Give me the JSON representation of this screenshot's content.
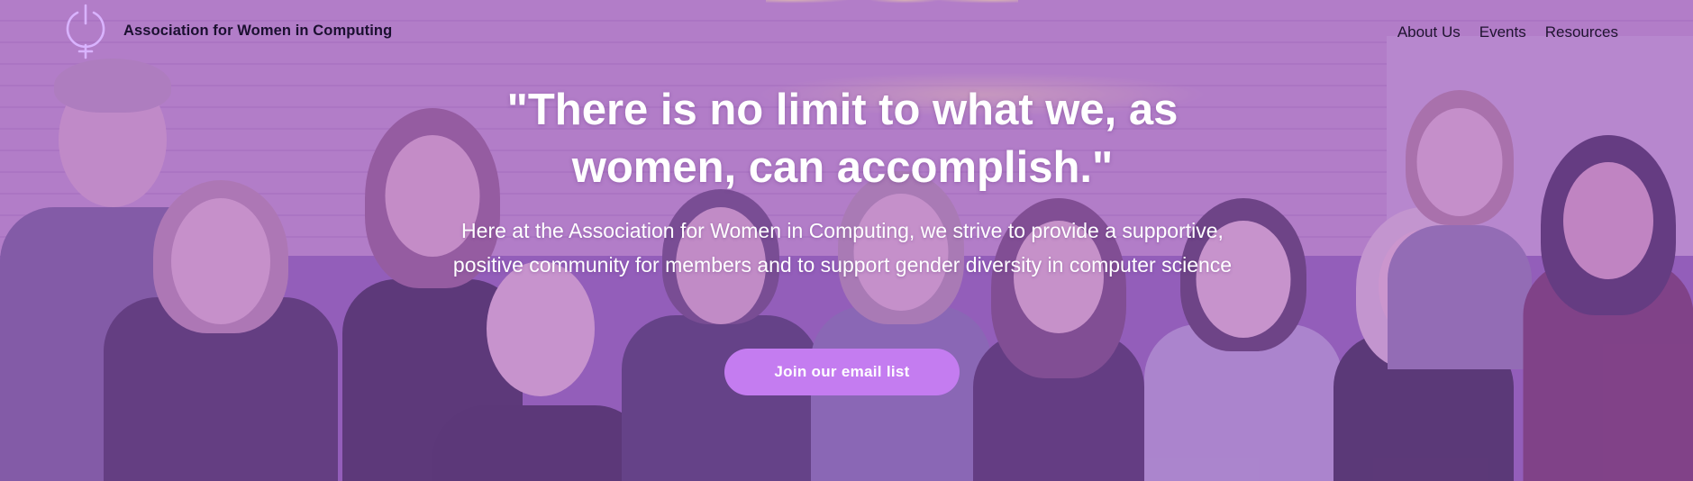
{
  "header": {
    "site_title": "Association for Women in Computing",
    "logo_icon": "venus-power-logo-icon",
    "nav": [
      {
        "label": "About Us"
      },
      {
        "label": "Events"
      },
      {
        "label": "Resources"
      }
    ]
  },
  "hero": {
    "quote": "\"There is no limit to what we, as women, can accomplish.\"",
    "subtext": "Here at the Association for Women in Computing, we strive to provide a supportive, positive community for members and to support gender diversity in computer science",
    "cta_label": "Join our email list",
    "background": "group-photo-with-purple-overlay"
  },
  "colors": {
    "overlay": "#a064c8",
    "cta": "#c47cf0",
    "logo_stroke": "#d9b3ff",
    "text_light": "#ffffff",
    "text_dark": "#1b1030"
  }
}
